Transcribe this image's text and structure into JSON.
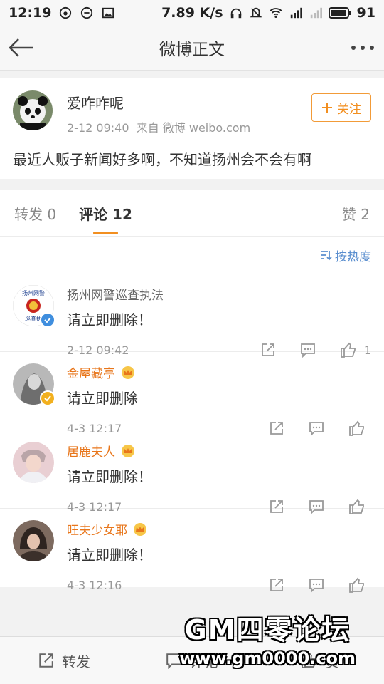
{
  "status_bar": {
    "time": "12:19",
    "speed": "7.89 K/s",
    "battery": "91"
  },
  "nav": {
    "title": "微博正文"
  },
  "post": {
    "author": "爱咋咋呢",
    "time": "2-12 09:40",
    "source": "来自 微博 weibo.com",
    "follow_label": "关注",
    "text": "最近人贩子新闻好多啊，不知道扬州会不会有啊"
  },
  "tabs": {
    "repost": "转发 0",
    "comments": "评论 12",
    "likes": "赞 2"
  },
  "sort": {
    "label": "按热度"
  },
  "comments": [
    {
      "name": "扬州网警巡查执法",
      "text": "请立即删除！",
      "time": "2-12 09:42",
      "like_count": "1"
    },
    {
      "name": "金屋藏亭",
      "text": "请立即删除",
      "time": "4-3 12:17",
      "like_count": ""
    },
    {
      "name": "居鹿夫人",
      "text": "请立即删除！",
      "time": "4-3 12:17",
      "like_count": ""
    },
    {
      "name": "旺夫少女耶",
      "text": "请立即删除！",
      "time": "4-3 12:16",
      "like_count": ""
    }
  ],
  "police_avatar_text": {
    "top": "扬州网警",
    "bottom": "巡查执"
  },
  "bottom_bar": {
    "repost": "转发",
    "comment": "评论",
    "like": "赞"
  },
  "watermark": {
    "line1": "GM四零论坛",
    "line2": "www.gm0000.com"
  },
  "colors": {
    "accent": "#f28f20",
    "link_blue": "#5b8fcf",
    "vip_orange": "#e8761b"
  }
}
